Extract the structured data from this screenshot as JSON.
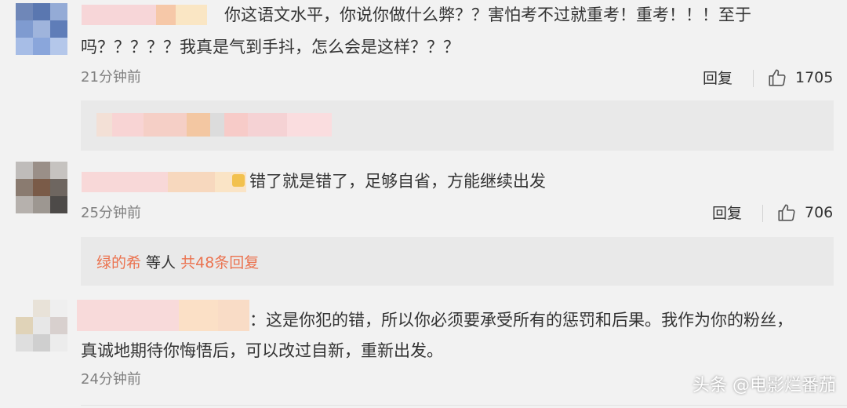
{
  "comments": [
    {
      "text_line1": "你这语文水平，你说你做什么弊？？害怕考不过就重考！重考！！！至于",
      "text_line2": "吗？？？？？我真是气到手抖，怎么会是这样？？？",
      "time": "21分钟前",
      "reply_label": "回复",
      "likes": "1705"
    },
    {
      "text": "错了就是错了，足够自省，方能继续出发",
      "time": "25分钟前",
      "reply_label": "回复",
      "likes": "706",
      "sub_first": "绿的希",
      "sub_middle": " 等人 ",
      "sub_link": "共48条回复"
    },
    {
      "text_line1": "：这是你犯的错，所以你必须要承受所有的惩罚和后果。我作为你的粉丝，",
      "text_line2": "真诚地期待你悔悟后，可以改过自新，重新出发。",
      "time": "24分钟前"
    }
  ],
  "watermark": "头条 @电影烂番茄",
  "colors": {
    "accent": "#eb7350",
    "background": "#f2f2f2",
    "subbox": "#e9e9e9"
  },
  "icons": [
    "thumbs-up-icon"
  ]
}
